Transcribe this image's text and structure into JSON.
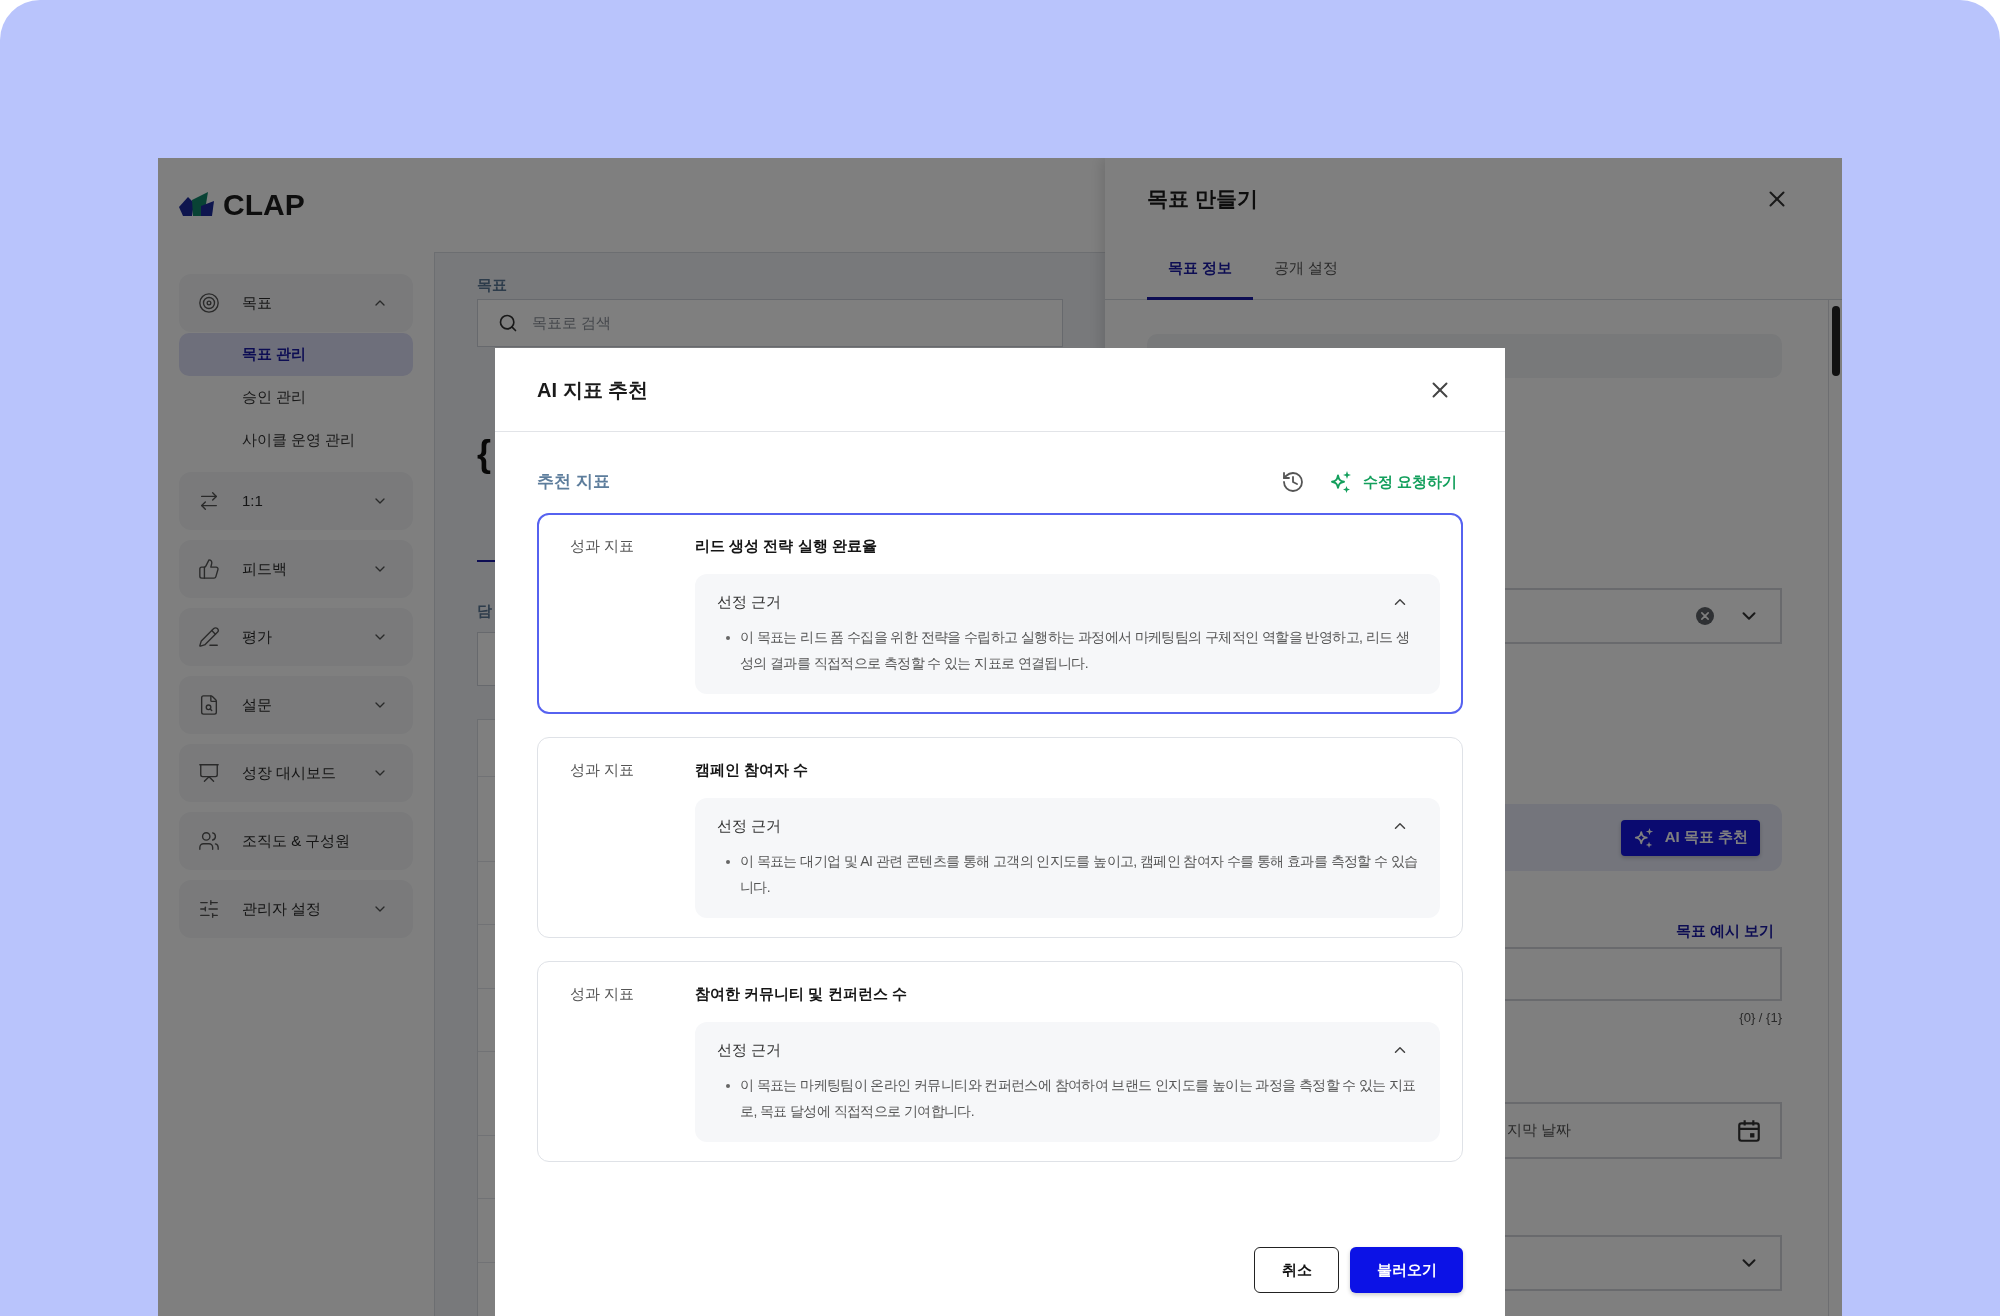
{
  "app": {
    "logo": {
      "text": "CLAP"
    },
    "sidebar": {
      "items": [
        {
          "kind": "group",
          "label": "목표",
          "expanded": true,
          "children": [
            {
              "label": "목표 관리",
              "selected": true
            },
            {
              "label": "승인 관리",
              "selected": false
            },
            {
              "label": "사이클 운영 관리",
              "selected": false
            }
          ]
        },
        {
          "kind": "group",
          "label": "1:1",
          "expanded": false
        },
        {
          "kind": "group",
          "label": "피드백",
          "expanded": false
        },
        {
          "kind": "group",
          "label": "평가",
          "expanded": false
        },
        {
          "kind": "group",
          "label": "설문",
          "expanded": false
        },
        {
          "kind": "group",
          "label": "성장 대시보드",
          "expanded": false
        },
        {
          "kind": "link",
          "label": "조직도 & 구성원"
        },
        {
          "kind": "group",
          "label": "관리자 설정",
          "expanded": false
        }
      ]
    },
    "main": {
      "search_label": "목표",
      "search": {
        "placeholder": "목표로 검색"
      },
      "title": "{",
      "field_label": "담"
    },
    "drawer": {
      "title": "목표 만들기",
      "tabs": [
        {
          "label": "목표 정보",
          "selected": true
        },
        {
          "label": "공개 설정",
          "selected": false
        }
      ],
      "ai_button": "AI 목표 추천",
      "example_link": "목표 예시 보기",
      "counter": "{0} / {1}",
      "date_field": {
        "placeholder": "지막 날짜"
      }
    }
  },
  "modal": {
    "title": "AI 지표 추천",
    "section_title": "추천 지표",
    "request_button": "수정 요청하기",
    "metrics": [
      {
        "type_label": "성과 지표",
        "title": "리드 생성 전략 실행 완료율",
        "selected": true,
        "reason_title": "선정 근거",
        "expanded": true,
        "reasons": [
          "이 목표는 리드 폼 수집을 위한 전략을 수립하고 실행하는 과정에서 마케팅팀의 구체적인 역할을 반영하고, 리드 생성의 결과를 직접적으로 측정할 수 있는 지표로 연결됩니다."
        ]
      },
      {
        "type_label": "성과 지표",
        "title": "캠페인 참여자 수",
        "selected": false,
        "reason_title": "선정 근거",
        "expanded": true,
        "reasons": [
          "이 목표는 대기업 및 AI 관련 콘텐츠를 통해 고객의 인지도를 높이고, 캠페인 참여자 수를 통해 효과를 측정할 수 있습니다."
        ]
      },
      {
        "type_label": "성과 지표",
        "title": "참여한 커뮤니티 및 컨퍼런스 수",
        "selected": false,
        "reason_title": "선정 근거",
        "expanded": true,
        "reasons": [
          "이 목표는 마케팅팀이 온라인 커뮤니티와 컨퍼런스에 참여하여 브랜드 인지도를 높이는 과정을 측정할 수 있는 지표로, 목표 달성에 직접적으로 기여합니다."
        ]
      }
    ],
    "buttons": [
      {
        "kind": "secondary",
        "label": "취소"
      },
      {
        "kind": "primary",
        "label": "불러오기"
      }
    ]
  }
}
